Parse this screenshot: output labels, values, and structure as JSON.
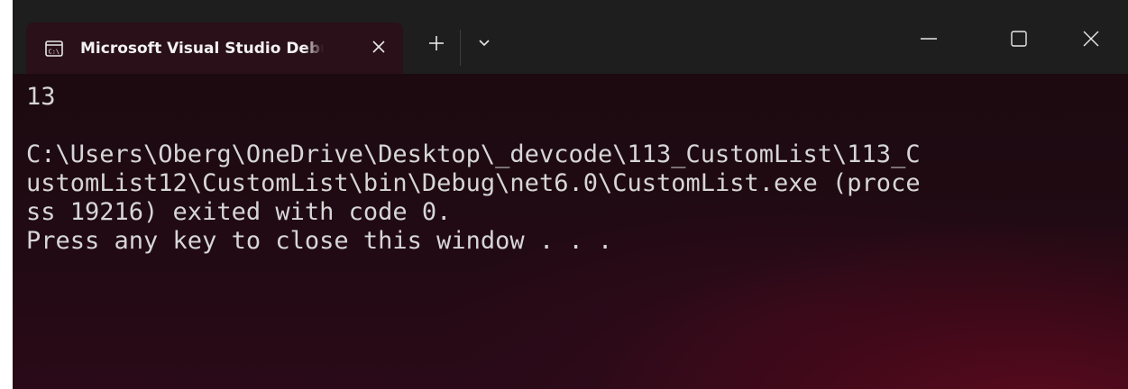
{
  "tab": {
    "title": "Microsoft Visual Studio Debug Console",
    "icon": "console-app-icon",
    "close_icon": "close-icon"
  },
  "titlebar": {
    "new_tab_icon": "plus-icon",
    "dropdown_icon": "chevron-down-icon",
    "minimize_icon": "minimize-icon",
    "maximize_icon": "maximize-icon",
    "close_icon": "close-icon"
  },
  "console": {
    "lines": [
      "13",
      "",
      "C:\\Users\\Oberg\\OneDrive\\Desktop\\_devcode\\113_CustomList\\113_C",
      "ustomList12\\CustomList\\bin\\Debug\\net6.0\\CustomList.exe (proce",
      "ss 19216) exited with code 0.",
      "Press any key to close this window . . ."
    ]
  },
  "colors": {
    "titlebar": "#1e1e1e",
    "tab": "#2a1018",
    "text": "#d6d6d6",
    "accent_glow": "#5a0a1e"
  }
}
